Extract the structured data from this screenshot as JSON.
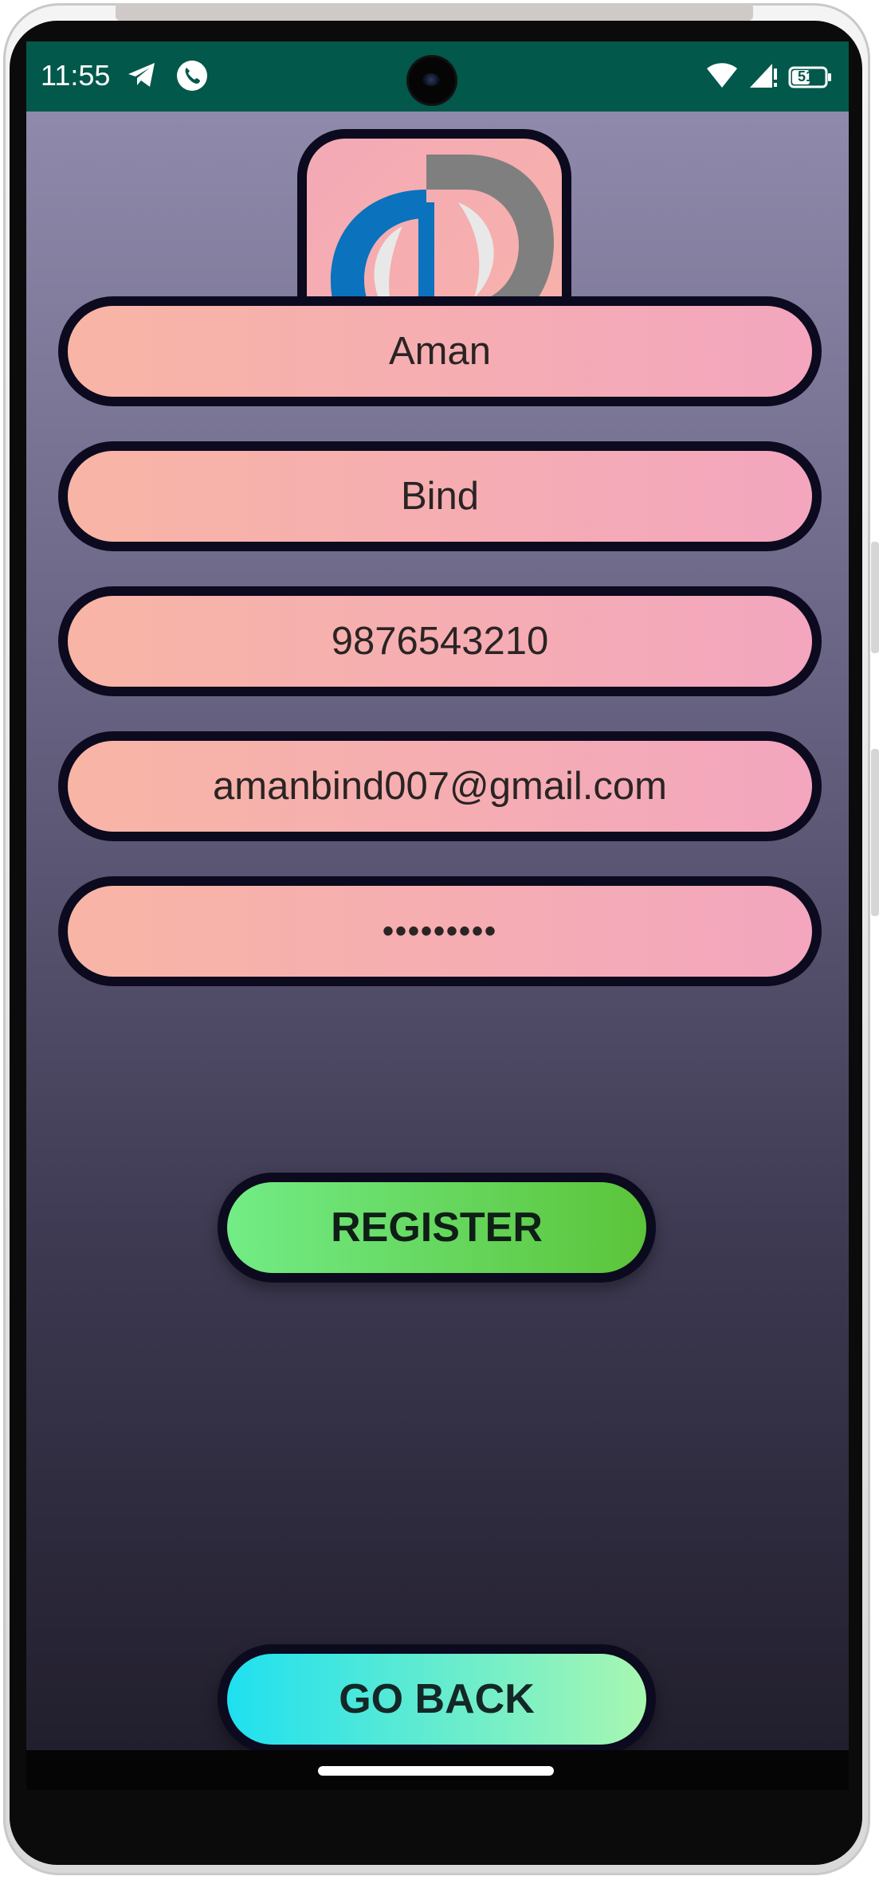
{
  "status_bar": {
    "time": "11:55",
    "battery": "51",
    "left_icons": [
      "telegram-icon",
      "whatsapp-call-icon"
    ],
    "right_icons": [
      "wifi-icon",
      "signal-icon",
      "battery-icon"
    ],
    "color": "#02584a"
  },
  "form": {
    "first_name": "Aman",
    "last_name": "Bind",
    "phone": "9876543210",
    "email": "amanbind007@gmail.com",
    "password": "•••••••••"
  },
  "buttons": {
    "register": "REGISTER",
    "go_back": "GO BACK"
  },
  "colors": {
    "field_gradient_start": "#f8b5a5",
    "field_gradient_end": "#f3a6be",
    "register_start": "#72ec86",
    "register_end": "#5bc43a",
    "goback_start": "#1fe0f0",
    "goback_end": "#a8f7b0",
    "logo_blue": "#0b72bd",
    "logo_gray": "#7f7f7f"
  }
}
